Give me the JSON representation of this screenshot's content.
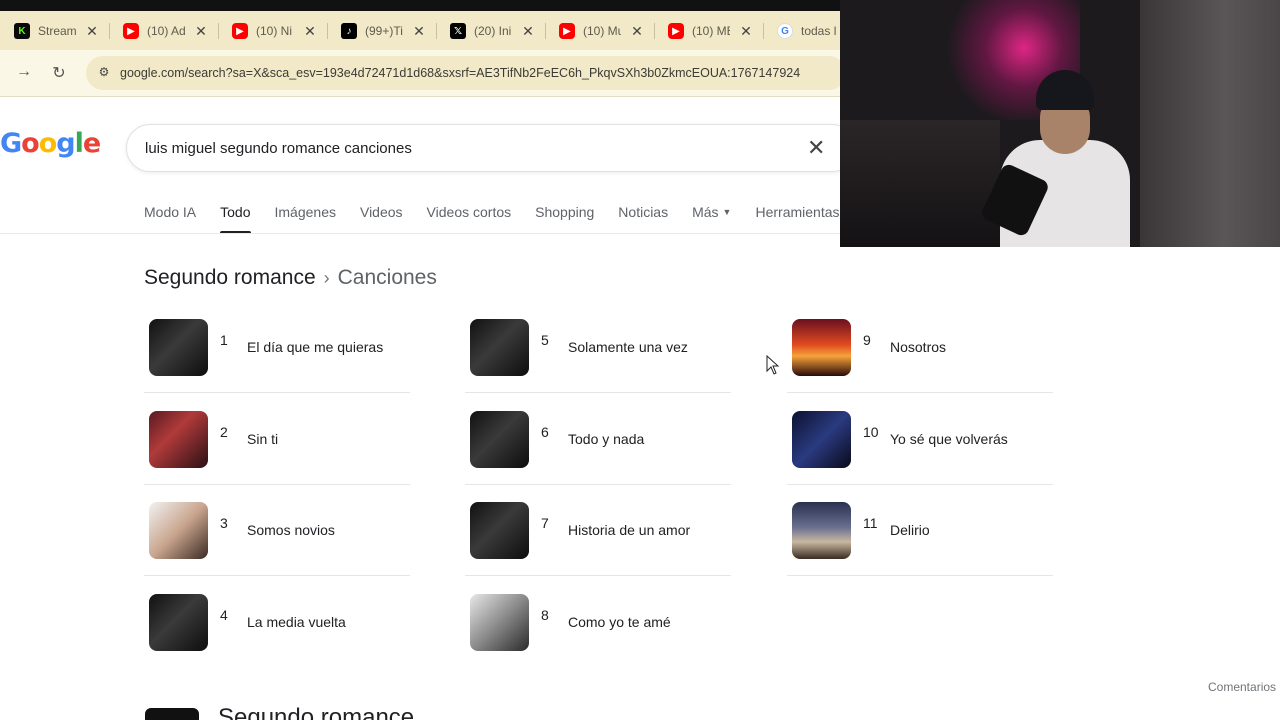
{
  "browser": {
    "tabs": [
      {
        "title": "Stream",
        "icon": "kick-icon",
        "glyph": "K"
      },
      {
        "title": "(10) Ad",
        "icon": "youtube-icon",
        "glyph": "▶"
      },
      {
        "title": "(10) Ni",
        "icon": "youtube-icon",
        "glyph": "▶"
      },
      {
        "title": "(99+)Ti",
        "icon": "tiktok-icon",
        "glyph": "♪"
      },
      {
        "title": "(20) Ini",
        "icon": "x-icon",
        "glyph": "𝕏"
      },
      {
        "title": "(10) Mu",
        "icon": "youtube-icon",
        "glyph": "▶"
      },
      {
        "title": "(10) ME",
        "icon": "youtube-icon",
        "glyph": "▶"
      },
      {
        "title": "todas l",
        "icon": "google-icon",
        "glyph": "G"
      }
    ],
    "url": "google.com/search?sa=X&sca_esv=193e4d72471d1d68&sxsrf=AE3TifNb2FeEC6h_PkqvSXh3b0ZkmcEOUA:1767147924"
  },
  "search": {
    "logo": [
      "G",
      "o",
      "o",
      "g",
      "l",
      "e"
    ],
    "query": "luis miguel segundo romance canciones",
    "tabs": [
      {
        "label": "Modo IA"
      },
      {
        "label": "Todo",
        "active": true
      },
      {
        "label": "Imágenes"
      },
      {
        "label": "Videos"
      },
      {
        "label": "Videos cortos"
      },
      {
        "label": "Shopping"
      },
      {
        "label": "Noticias"
      },
      {
        "label": "Más",
        "caret": true
      },
      {
        "label": "Herramientas"
      }
    ]
  },
  "breadcrumb": {
    "album": "Segundo romance",
    "section": "Canciones"
  },
  "songs": [
    {
      "num": "1",
      "title": "El día que me quieras",
      "thumb": "t-dark"
    },
    {
      "num": "2",
      "title": "Sin ti",
      "thumb": "t-red"
    },
    {
      "num": "3",
      "title": "Somos novios",
      "thumb": "t-face"
    },
    {
      "num": "4",
      "title": "La media vuelta",
      "thumb": "t-dark"
    },
    {
      "num": "5",
      "title": "Solamente una vez",
      "thumb": "t-dark"
    },
    {
      "num": "6",
      "title": "Todo y nada",
      "thumb": "t-dark"
    },
    {
      "num": "7",
      "title": "Historia de un amor",
      "thumb": "t-dark"
    },
    {
      "num": "8",
      "title": "Como yo te amé",
      "thumb": "t-gray"
    },
    {
      "num": "9",
      "title": "Nosotros",
      "thumb": "t-sunset"
    },
    {
      "num": "10",
      "title": "Yo sé que volverás",
      "thumb": "t-blue"
    },
    {
      "num": "11",
      "title": "Delirio",
      "thumb": "t-crowd"
    }
  ],
  "feedback": "Comentarios",
  "next_section_title": "Segundo romance",
  "colors": {
    "active_tab_underline": "#202124",
    "tabstrip": "#f1e9c7",
    "webcam_glow": "#ff2896"
  }
}
